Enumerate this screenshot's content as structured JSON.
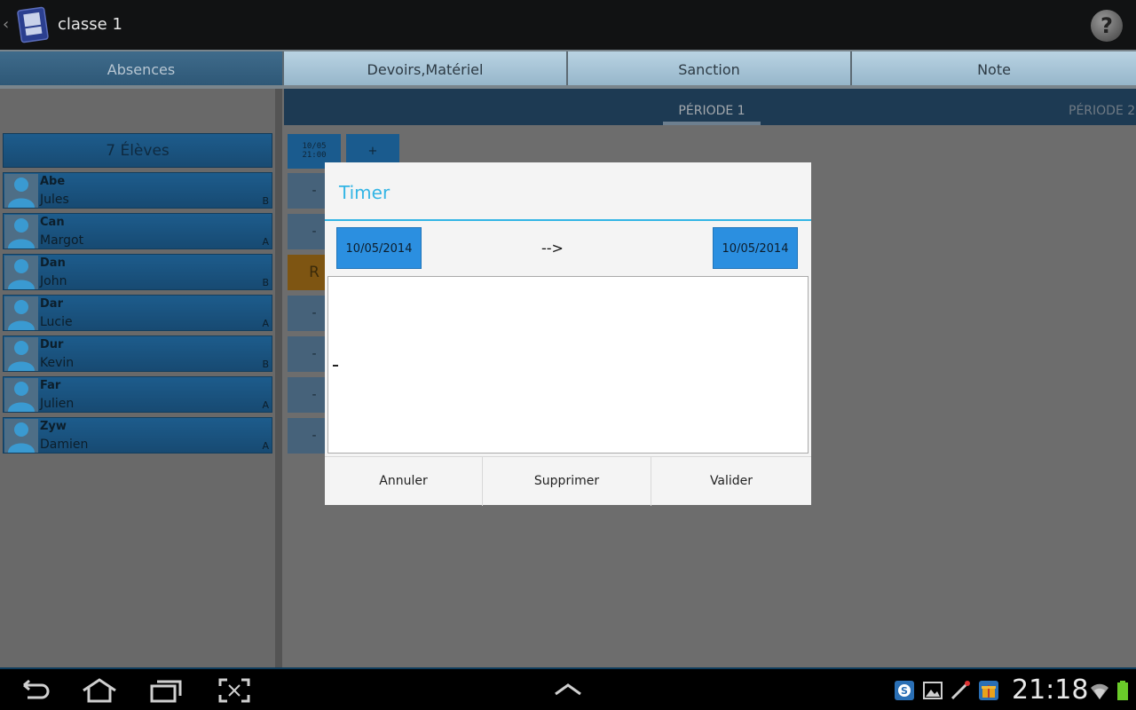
{
  "actionbar": {
    "title": "classe 1",
    "back_glyph": "‹",
    "help_glyph": "?",
    "app_icon": "book-icon"
  },
  "tabs": [
    {
      "label": "Absences",
      "active": true
    },
    {
      "label": "Devoirs,Matériel",
      "active": false
    },
    {
      "label": "Sanction",
      "active": false
    },
    {
      "label": "Note",
      "active": false
    }
  ],
  "left_pane": {
    "header": "7 Élèves",
    "students": [
      {
        "last": "Abe",
        "first": "Jules",
        "group": "B"
      },
      {
        "last": "Can",
        "first": "Margot",
        "group": "A"
      },
      {
        "last": "Dan",
        "first": "John",
        "group": "B"
      },
      {
        "last": "Dar",
        "first": "Lucie",
        "group": "A"
      },
      {
        "last": "Dur",
        "first": "Kevin",
        "group": "B"
      },
      {
        "last": "Far",
        "first": "Julien",
        "group": "A"
      },
      {
        "last": "Zyw",
        "first": "Damien",
        "group": "A"
      }
    ]
  },
  "right_pane": {
    "period_1": "PÉRIODE 1",
    "period_2": "PÉRIODE 2",
    "date_cell_line1": "10/05",
    "date_cell_line2": "21:00",
    "plus_label": "+",
    "dash": "-",
    "r_label": "R"
  },
  "dialog": {
    "title": "Timer",
    "start_date": "10/05/2014",
    "arrow": "-->",
    "end_date": "10/05/2014",
    "textarea_value": "",
    "cancel": "Annuler",
    "delete": "Supprimer",
    "validate": "Valider"
  },
  "sysbar": {
    "clock": "21:18",
    "nav_icons": [
      "back-icon",
      "home-icon",
      "recent-apps-icon",
      "screenshot-icon",
      "up-chevron-icon"
    ],
    "tray_icons": [
      "skype-icon",
      "gallery-icon",
      "pen-icon",
      "gift-icon",
      "wifi-icon",
      "battery-icon"
    ]
  },
  "colors": {
    "accent": "#33b5e5",
    "date_button": "#2b8fe0",
    "tab_active": "#3f6b8b",
    "r_cell": "#7e5512"
  }
}
